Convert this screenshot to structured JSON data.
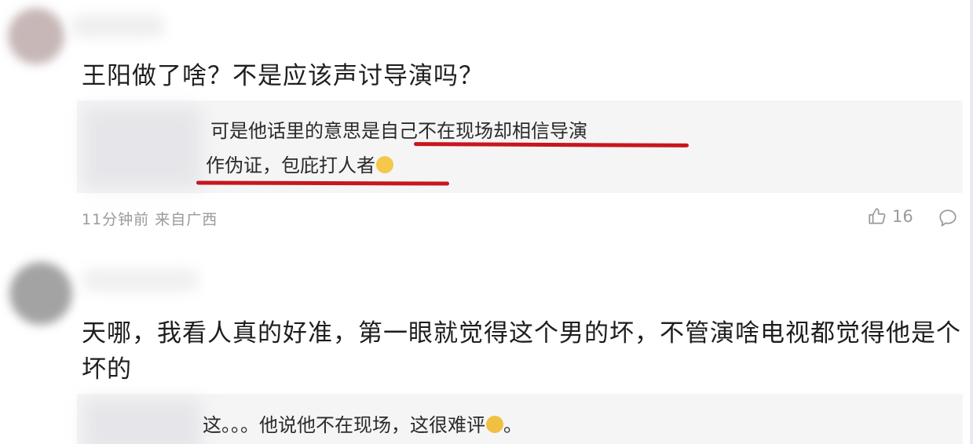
{
  "comments": [
    {
      "text": "王阳做了啥？不是应该声讨导演吗？",
      "reply": {
        "line1_prefix": "可是他话里的意思是",
        "line1_highlight": "自己不在现场却相信导演",
        "line2_highlight": "作伪证，包庇打人者"
      },
      "meta": {
        "time": "11分钟前",
        "source": "来自广西",
        "likes": "16"
      }
    },
    {
      "text": "天哪，我看人真的好准，第一眼就觉得这个男的坏，不管演啥电视都觉得他是个坏的",
      "reply": {
        "line1": "这。。。他说他不在现场，这很难评",
        "line1_end": "。"
      }
    }
  ],
  "icons": {
    "like": "thumbs-up-icon",
    "comment": "comment-bubble-icon",
    "emoji_smile": "smile-emoji-icon",
    "emoji_laugh": "laugh-emoji-icon"
  },
  "colors": {
    "underline": "#c8161d",
    "quote_bg": "#f5f5f6",
    "meta_text": "#9a9a9a"
  }
}
